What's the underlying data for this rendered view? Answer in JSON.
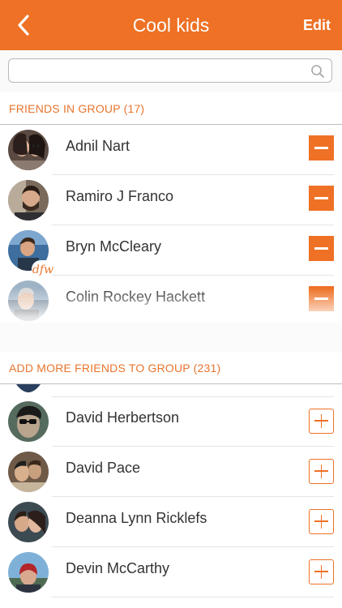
{
  "header": {
    "title": "Cool kids",
    "edit_label": "Edit",
    "back_icon": "chevron-left-icon"
  },
  "search": {
    "placeholder": "",
    "value": "",
    "icon": "search-icon"
  },
  "group_section": {
    "header": "FRIENDS IN GROUP (17)",
    "members": [
      {
        "name": "Adnil Nart",
        "action": "remove"
      },
      {
        "name": "Ramiro J Franco",
        "action": "remove"
      },
      {
        "name": "Bryn McCleary",
        "action": "remove"
      },
      {
        "name": "Colin Rockey Hackett",
        "action": "remove"
      }
    ]
  },
  "add_section": {
    "header": "ADD MORE FRIENDS TO GROUP (231)",
    "friends": [
      {
        "name": "David Herbertson",
        "action": "add"
      },
      {
        "name": "David Pace",
        "action": "add"
      },
      {
        "name": "Deanna Lynn Ricklefs",
        "action": "add"
      },
      {
        "name": "Devin McCarthy",
        "action": "add"
      }
    ]
  },
  "colors": {
    "accent": "#ee7125",
    "section_text": "#e8752d",
    "name_text": "#333333"
  }
}
